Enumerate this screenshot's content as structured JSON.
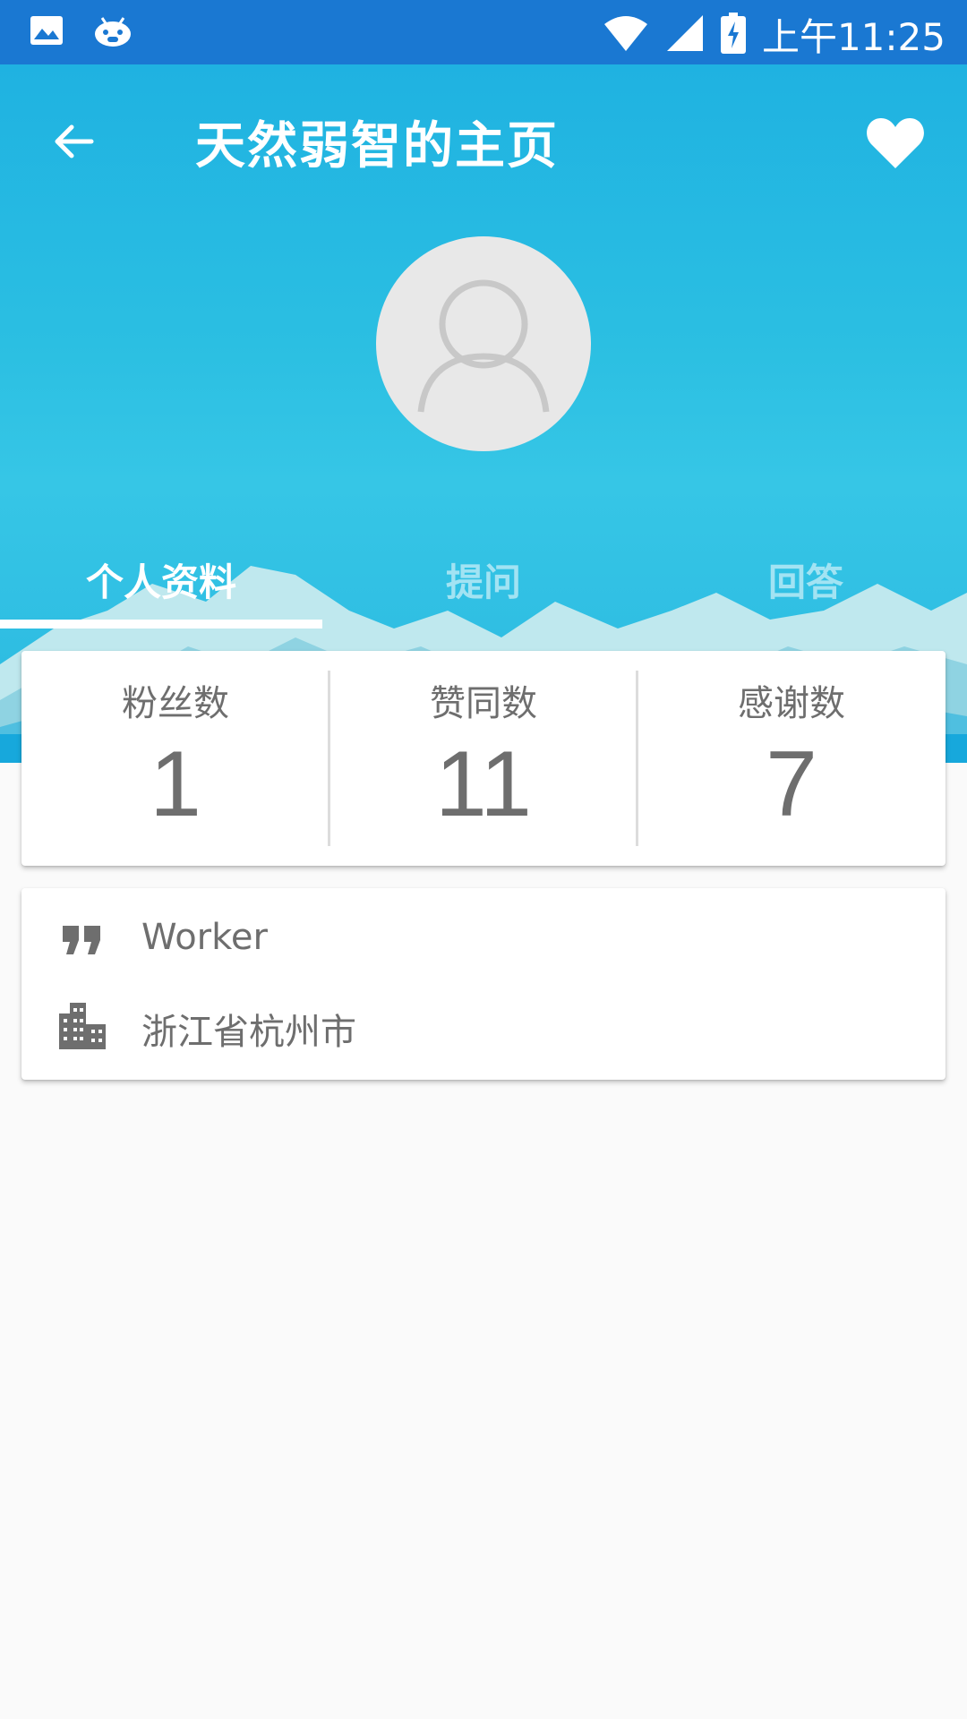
{
  "status_bar": {
    "time": "上午11:25",
    "icons": [
      "image-icon",
      "android-debug-icon",
      "wifi-icon",
      "cell-signal-icon",
      "battery-charging-icon"
    ]
  },
  "header": {
    "title": "天然弱智的主页",
    "back_icon": "arrow-back-icon",
    "favorite_icon": "heart-icon",
    "avatar_icon": "default-user-icon"
  },
  "tabs": [
    {
      "label": "个人资料",
      "active": true
    },
    {
      "label": "提问",
      "active": false
    },
    {
      "label": "回答",
      "active": false
    }
  ],
  "stats": [
    {
      "label": "粉丝数",
      "value": "1"
    },
    {
      "label": "赞同数",
      "value": "11"
    },
    {
      "label": "感谢数",
      "value": "7"
    }
  ],
  "info": {
    "bio": {
      "icon": "quote-icon",
      "text": "Worker"
    },
    "location": {
      "icon": "building-icon",
      "text": "浙江省杭州市"
    }
  },
  "colors": {
    "status_bar": "#1a78d2",
    "header": "#1fb2e1",
    "text_gray": "#6e6e6e",
    "background": "#fafafa"
  }
}
